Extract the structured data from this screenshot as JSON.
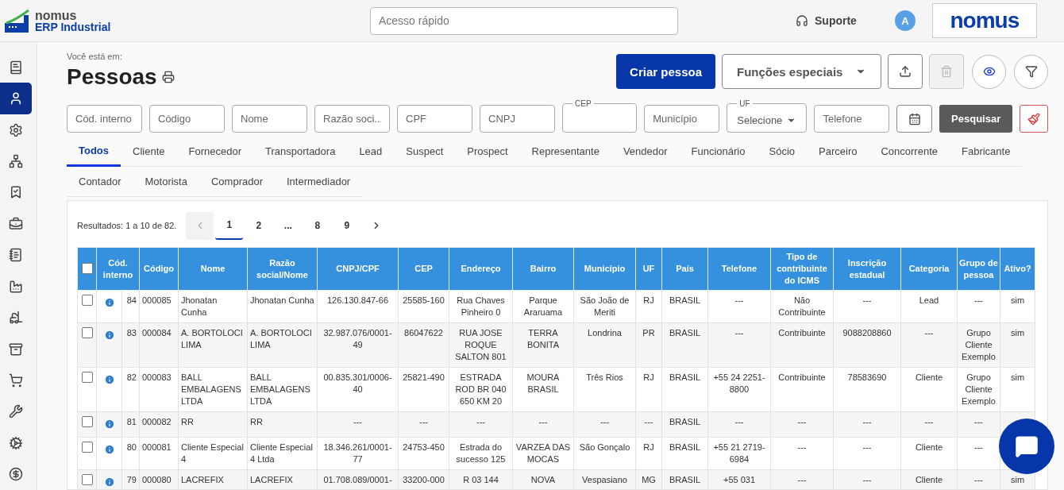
{
  "topbar": {
    "logo": {
      "line1": "nomus",
      "line2": "ERP Industrial"
    },
    "search": {
      "placeholder": "Acesso rápido"
    },
    "support": "Suporte",
    "avatar": "A",
    "brand": "nomus"
  },
  "sidebar": {
    "items": [
      {
        "selected": false
      },
      {
        "selected": true
      },
      {
        "selected": false
      },
      {
        "selected": false
      },
      {
        "selected": false
      },
      {
        "selected": false
      },
      {
        "selected": false
      },
      {
        "selected": false
      },
      {
        "selected": false
      },
      {
        "selected": false
      },
      {
        "selected": false
      },
      {
        "selected": false
      },
      {
        "selected": false
      },
      {
        "selected": false
      }
    ]
  },
  "page": {
    "breadcrumb": "Você está em:",
    "title": "Pessoas"
  },
  "actions": {
    "primary": "Criar pessoa",
    "dropdown": "Funções especiais",
    "icon_buttons": [
      {
        "kind": "upload",
        "disabled": false
      },
      {
        "kind": "delete",
        "disabled": true
      },
      {
        "kind": "view",
        "disabled": false
      },
      {
        "kind": "filter",
        "disabled": false
      }
    ]
  },
  "filters": [
    {
      "kind": "text",
      "placeholder": "Cód. interno"
    },
    {
      "kind": "text",
      "placeholder": "Código"
    },
    {
      "kind": "text",
      "placeholder": "Nome"
    },
    {
      "kind": "text",
      "placeholder": "Razão soci..."
    },
    {
      "kind": "text",
      "placeholder": "CPF"
    },
    {
      "kind": "text",
      "placeholder": "CNPJ"
    },
    {
      "kind": "labeled",
      "label": "CEP"
    },
    {
      "kind": "text",
      "placeholder": "Município"
    },
    {
      "kind": "select",
      "label": "UF",
      "value": "Selecione"
    },
    {
      "kind": "text",
      "placeholder": "Telefone"
    },
    {
      "kind": "date"
    }
  ],
  "search_button": "Pesquisar",
  "tabs": [
    {
      "label": "Todos",
      "selected": true
    },
    {
      "label": "Cliente",
      "selected": false
    },
    {
      "label": "Fornecedor",
      "selected": false
    },
    {
      "label": "Transportadora",
      "selected": false
    },
    {
      "label": "Lead",
      "selected": false
    },
    {
      "label": "Suspect",
      "selected": false
    },
    {
      "label": "Prospect",
      "selected": false
    },
    {
      "label": "Representante",
      "selected": false
    },
    {
      "label": "Vendedor",
      "selected": false
    },
    {
      "label": "Funcionário",
      "selected": false
    },
    {
      "label": "Sócio",
      "selected": false
    },
    {
      "label": "Parceiro",
      "selected": false
    },
    {
      "label": "Concorrente",
      "selected": false
    },
    {
      "label": "Fabricante",
      "selected": false
    },
    {
      "label": "Contador",
      "selected": false
    },
    {
      "label": "Motorista",
      "selected": false
    },
    {
      "label": "Comprador",
      "selected": false
    },
    {
      "label": "Intermediador",
      "selected": false
    }
  ],
  "results": {
    "summary": "Resultados: 1 a 10 de 82.",
    "pages": [
      {
        "label": "1",
        "selected": true
      },
      {
        "label": "2",
        "selected": false
      },
      {
        "label": "...",
        "selected": false
      },
      {
        "label": "8",
        "selected": false
      },
      {
        "label": "9",
        "selected": false
      }
    ]
  },
  "table": {
    "select_all": {
      "checked": false
    },
    "columns": [
      "Cód. interno",
      "Código",
      "Nome",
      "Razão social/Nome",
      "CNPJ/CPF",
      "CEP",
      "Endereço",
      "Bairro",
      "Município",
      "UF",
      "País",
      "Telefone",
      "Tipo de contribuinte do ICMS",
      "Inscrição estadual",
      "Categoria",
      "Grupo de pessoa",
      "Ativo?"
    ],
    "rows": [
      {
        "checked": false,
        "cells": [
          "84",
          "000085",
          "Jhonatan Cunha",
          "Jhonatan Cunha",
          "126.130.847-66",
          "25585-160",
          "Rua Chaves Pinheiro 0",
          "Parque Araruama",
          "São João de Meriti",
          "RJ",
          "BRASIL",
          "---",
          "Não Contribuinte",
          "---",
          "Lead",
          "---",
          "sim"
        ]
      },
      {
        "checked": false,
        "cells": [
          "83",
          "000084",
          "A. BORTOLOCI LIMA",
          "A. BORTOLOCI LIMA",
          "32.987.076/0001-49",
          "86047622",
          "RUA JOSE ROQUE SALTON 801",
          "TERRA BONITA",
          "Londrina",
          "PR",
          "BRASIL",
          "---",
          "Contribuinte",
          "9088208860",
          "---",
          "Grupo Cliente Exemplo",
          "sim"
        ]
      },
      {
        "checked": false,
        "cells": [
          "82",
          "000083",
          "BALL EMBALAGENS LTDA",
          "BALL EMBALAGENS LTDA",
          "00.835.301/0006-40",
          "25821-490",
          "ESTRADA ROD BR 040 650 KM 20",
          "MOURA BRASIL",
          "Três Rios",
          "RJ",
          "BRASIL",
          "+55 24 2251-8800",
          "Contribuinte",
          "78583690",
          "Cliente",
          "Grupo Cliente Exemplo",
          "sim"
        ]
      },
      {
        "checked": false,
        "cells": [
          "81",
          "000082",
          "RR",
          "RR",
          "---",
          "---",
          "---",
          "---",
          "---",
          "---",
          "BRASIL",
          "---",
          "---",
          "---",
          "---",
          "---"
        ]
      },
      {
        "checked": false,
        "cells": [
          "80",
          "000081",
          "Cliente Especial 4",
          "Cliente Especial 4 Ltda",
          "18.346.261/0001-77",
          "24753-450",
          "Estrada do sucesso 125",
          "VARZEA DAS MOCAS",
          "São Gonçalo",
          "RJ",
          "BRASIL",
          "+55 21 2719-6984",
          "---",
          "---",
          "Cliente",
          "---"
        ]
      },
      {
        "checked": false,
        "cells": [
          "79",
          "000080",
          "LACREFIX",
          "LACREFIX",
          "01.708.089/0001-",
          "33200-000",
          "R 03 144",
          "NOVA",
          "Vespasiano",
          "MG",
          "BRASIL",
          "+55 031",
          "---",
          "---",
          "Cliente",
          "---",
          "sim"
        ]
      }
    ]
  }
}
